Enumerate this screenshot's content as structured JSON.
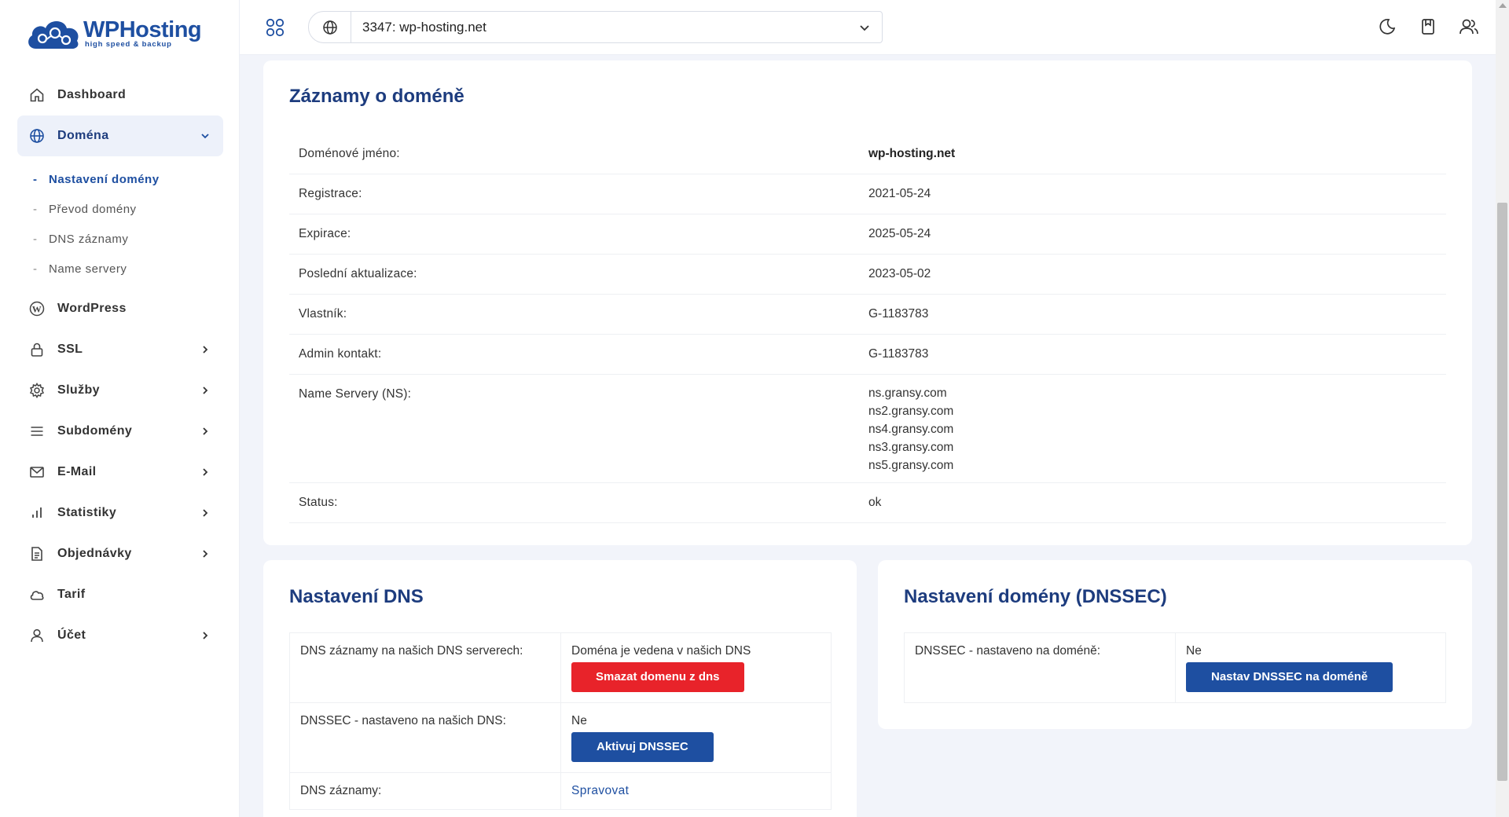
{
  "brand": {
    "name": "WPHosting",
    "tagline": "high speed & backup",
    "color": "#1e4fa1"
  },
  "sidebar": {
    "items": [
      {
        "label": "Dashboard",
        "icon": "home-icon"
      },
      {
        "label": "Doména",
        "icon": "globe-icon",
        "expanded": true
      },
      {
        "label": "WordPress",
        "icon": "wordpress-icon"
      },
      {
        "label": "SSL",
        "icon": "lock-icon"
      },
      {
        "label": "Služby",
        "icon": "gear-icon"
      },
      {
        "label": "Subdomény",
        "icon": "menu-icon"
      },
      {
        "label": "E-Mail",
        "icon": "mail-icon"
      },
      {
        "label": "Statistiky",
        "icon": "bar-chart-icon"
      },
      {
        "label": "Objednávky",
        "icon": "document-icon"
      },
      {
        "label": "Tarif",
        "icon": "cloud-icon"
      },
      {
        "label": "Účet",
        "icon": "user-icon"
      }
    ],
    "domain_sub": [
      {
        "label": "Nastavení domény",
        "active": true
      },
      {
        "label": "Převod domény"
      },
      {
        "label": "DNS záznamy"
      },
      {
        "label": "Name servery"
      }
    ]
  },
  "topbar": {
    "selected_domain": "3347: wp-hosting.net",
    "icons": [
      "apps-icon",
      "globe-icon",
      "chevron-down-icon",
      "moon-icon",
      "bookmark-icon",
      "users-icon"
    ]
  },
  "records": {
    "title": "Záznamy o doméně",
    "rows": [
      {
        "key": "Doménové jméno:",
        "value": "wp-hosting.net"
      },
      {
        "key": "Registrace:",
        "value": "2021-05-24"
      },
      {
        "key": "Expirace:",
        "value": "2025-05-24"
      },
      {
        "key": "Poslední aktualizace:",
        "value": "2023-05-02"
      },
      {
        "key": "Vlastník:",
        "value": "G-1183783"
      },
      {
        "key": "Admin kontakt:",
        "value": "G-1183783"
      },
      {
        "key": "Name Servery (NS):",
        "values": [
          "ns.gransy.com",
          "ns2.gransy.com",
          "ns4.gransy.com",
          "ns3.gransy.com",
          "ns5.gransy.com"
        ]
      },
      {
        "key": "Status:",
        "value": "ok"
      }
    ]
  },
  "dns": {
    "title": "Nastavení DNS",
    "rows": [
      {
        "key": "DNS záznamy na našich DNS serverech:",
        "value": "Doména je vedena v našich DNS",
        "button": "Smazat domenu z dns"
      },
      {
        "key": "DNSSEC - nastaveno na našich DNS:",
        "value": "Ne",
        "button": "Aktivuj DNSSEC"
      },
      {
        "key": "DNS záznamy:",
        "link": "Spravovat"
      }
    ]
  },
  "dnssec": {
    "title": "Nastavení domény (DNSSEC)",
    "rows": [
      {
        "key": "DNSSEC - nastaveno na doméně:",
        "value": "Ne",
        "button": "Nastav DNSSEC na doméně"
      }
    ]
  },
  "colors": {
    "primary": "#1e4fa1",
    "danger": "#e8232a",
    "heading": "#1d3c7e"
  }
}
